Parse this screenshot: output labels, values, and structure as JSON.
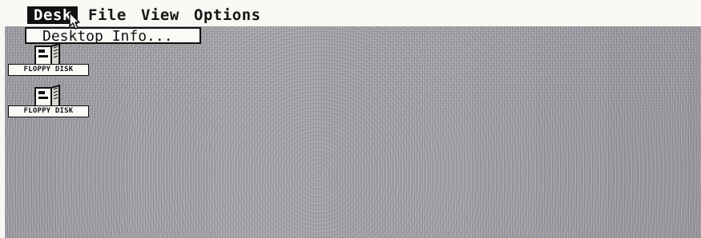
{
  "menubar": {
    "items": [
      "Desk",
      "File",
      "View",
      "Options"
    ],
    "active_item": "Desk"
  },
  "desk_menu": {
    "items": [
      "Desktop Info..."
    ]
  },
  "desktop": {
    "icons": [
      {
        "label": "FLOPPY DISK",
        "icon": "floppy-disk-drive-icon"
      },
      {
        "label": "FLOPPY DISK",
        "icon": "floppy-disk-drive-icon"
      }
    ]
  },
  "pointer": {
    "icon": "mouse-arrow-icon"
  },
  "colors": {
    "menubar_background": "#f9f8f4",
    "desktop_pattern": "#a3a0a8",
    "active_menu_background": "#111111",
    "active_menu_text": "#ffffff",
    "ink": "#111111"
  }
}
